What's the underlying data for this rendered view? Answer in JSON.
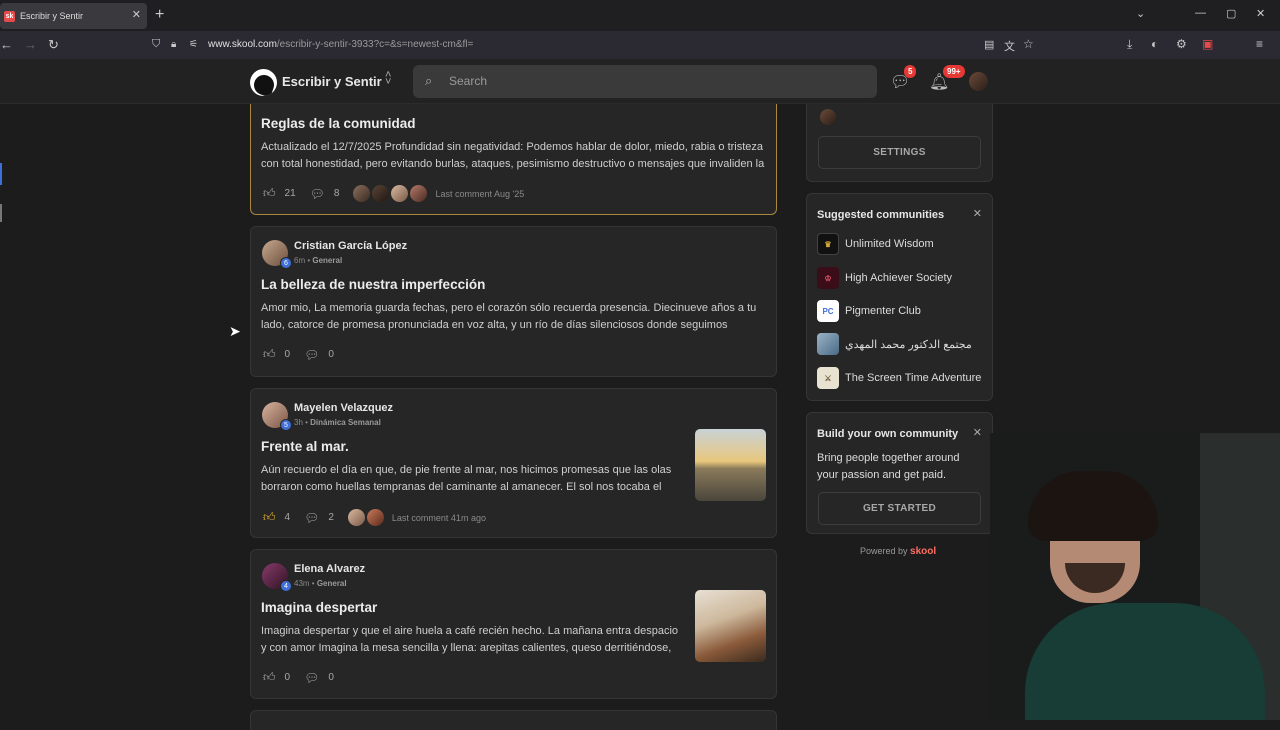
{
  "browser": {
    "tab_title": "Escribir y Sentir",
    "tab_favicon": "sk",
    "url_domain": "www.skool.com",
    "url_path": "/escribir-y-sentir-3933?c=&s=newest-cm&fl=",
    "ext_badge": "134",
    "ext_letter": "R"
  },
  "header": {
    "community_name": "Escribir y Sentir",
    "search_placeholder": "Search",
    "chat_badge": "5",
    "notif_badge": "99+"
  },
  "posts": [
    {
      "title": "Reglas de la comunidad",
      "body": "Actualizado el 12/7/2025 Profundidad sin negatividad: Podemos hablar de dolor, miedo, rabia o tristeza con total honestidad, pero evitando burlas, ataques, pesimismo destructivo o mensajes que invaliden la",
      "likes": "21",
      "comments": "8",
      "last_comment": "Last comment Aug '25"
    },
    {
      "author": "Cristian García López",
      "level": "6",
      "time": "6m",
      "category": "General",
      "title": "La belleza de nuestra imperfección",
      "body": "Amor mio, La memoria guarda fechas, pero el corazón sólo recuerda presencia. Diecinueve años a tu lado, catorce de promesa pronunciada en voz alta, y un río de días silenciosos donde seguimos",
      "likes": "0",
      "comments": "0"
    },
    {
      "author": "Mayelen Velazquez",
      "level": "5",
      "time": "3h",
      "category": "Dinámica Semanal",
      "title": "Frente al mar.",
      "body": "Aún recuerdo el día en que, de pie frente al mar, nos hicimos promesas que las olas borraron como huellas tempranas del caminante al amanecer. El sol nos tocaba el",
      "likes": "4",
      "comments": "2",
      "last_comment": "Last comment 41m ago"
    },
    {
      "author": "Elena Alvarez",
      "level": "4",
      "time": "43m",
      "category": "General",
      "title": "Imagina despertar",
      "body": "Imagina despertar y que el aire huela a café recién hecho. La mañana entra despacio y con amor Imagina la mesa sencilla y llena: arepitas calientes, queso derritiéndose,",
      "likes": "0",
      "comments": "0"
    }
  ],
  "sidebar": {
    "settings_label": "SETTINGS",
    "suggested_title": "Suggested communities",
    "communities": [
      {
        "name": "Unlimited Wisdom",
        "icon": "wisdom-logo"
      },
      {
        "name": "High Achiever Society",
        "icon": "crown-logo"
      },
      {
        "name": "Pigmenter Club",
        "icon": "PC"
      },
      {
        "name": "مجتمع الدكتور محمد المهدي",
        "icon": "portrait-logo"
      },
      {
        "name": "The Screen Time Adventure",
        "icon": "sword-logo"
      }
    ],
    "build_title": "Build your own community",
    "build_text": "Bring people together around your passion and get paid.",
    "build_button": "GET STARTED",
    "powered_by": "Powered by",
    "powered_brand": "skool"
  },
  "colors": {
    "accent_blue": "#3f6fd8",
    "badge_red": "#e53935",
    "pinned_border": "#a8893e"
  }
}
